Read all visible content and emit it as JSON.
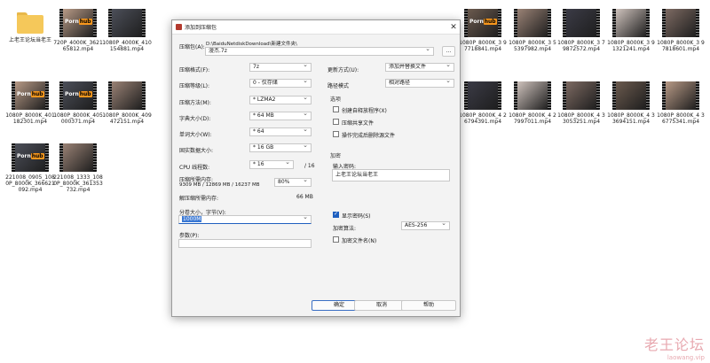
{
  "desktop": {
    "files": [
      {
        "name": "上老王论坛当老王",
        "kind": "folder"
      },
      {
        "name": "720P_4000K_362165812.mp4",
        "kind": "ph"
      },
      {
        "name": "1080P_4000K_410154881.mp4",
        "kind": "video"
      },
      {
        "name": "1080P_8000K_3 55397982.mp4",
        "kind": "video"
      },
      {
        "name": "1080P_8000K_3 79872572.mp4",
        "kind": "video"
      },
      {
        "name": "1080P_8000K_3 91321241.mp4",
        "kind": "video"
      },
      {
        "name": "1080P_8000K_3 97818601.mp4",
        "kind": "video"
      },
      {
        "name": "1080P_8000K_3 97718841.mp4",
        "kind": "ph"
      },
      {
        "name": "1080P_8000K_401182301.mp4",
        "kind": "ph"
      },
      {
        "name": "1080P_8000K_405000371.mp4",
        "kind": "ph"
      },
      {
        "name": "1080P_8000K_409472151.mp4",
        "kind": "video"
      },
      {
        "name": "1080P_8000K_4 26794391.mp4",
        "kind": "video"
      },
      {
        "name": "1080P_8000K_4 27997011.mp4",
        "kind": "video"
      },
      {
        "name": "1080P_8000K_4 33053251.mp4",
        "kind": "video"
      },
      {
        "name": "1080P_8000K_4 33694151.mp4",
        "kind": "video"
      },
      {
        "name": "1080P_8000K_4 36775341.mp4",
        "kind": "video"
      },
      {
        "name": "221008_0905_1080P_8000K_366621092.mp4",
        "kind": "ph"
      },
      {
        "name": "221008_1333_1080P_8000K_361353732.mp4",
        "kind": "video"
      }
    ],
    "ph_logo_text": "Porn",
    "ph_logo_badge": "hub"
  },
  "dialog": {
    "title": "添加到压缩包",
    "archive_label": "压缩包(A):",
    "archive_path": "D:\\BaiduNetdiskDownload\\新建文件夹\\",
    "archive_name": "漫杰.7z",
    "browse_label": "...",
    "format_label": "压缩格式(F):",
    "format_value": "7z",
    "level_label": "压缩等级(L):",
    "level_value": "0 - 仅存储",
    "method_label": "压缩方法(M):",
    "method_value": "* LZMA2",
    "dict_label": "字典大小(D):",
    "dict_value": "* 64 MB",
    "word_label": "单词大小(W):",
    "word_value": "* 64",
    "solid_label": "固实数据大小:",
    "solid_value": "* 16 GB",
    "cpu_label": "CPU 线程数:",
    "cpu_value": "* 16",
    "cpu_max": "/ 16",
    "mem_label": "压缩所需内存:",
    "mem_detail": "9309 MB / 12869 MB / 16237 MB",
    "mem_percent": "80%",
    "decomp_label": "解压缩所需内存:",
    "decomp_value": "66 MB",
    "split_label": "分卷大小，字节(V):",
    "split_value": "1000M",
    "params_label": "参数(P):",
    "params_value": "",
    "update_label": "更新方式(U):",
    "update_value": "添加并替换文件",
    "pathmode_label": "路径模式",
    "pathmode_value": "相对路径",
    "options_title": "选项",
    "opt_sfx": "创建自释放程序(X)",
    "opt_shared": "压缩共享文件",
    "opt_delete": "操作完成后删除源文件",
    "enc_title": "加密",
    "enc_pw_label": "输入密码:",
    "enc_pw_value": "上老王论坛当老王",
    "enc_show": "显示密码(S)",
    "enc_method_label": "加密算法:",
    "enc_method_value": "AES-256",
    "enc_names": "加密文件名(N)",
    "ok": "确定",
    "cancel": "取消",
    "help": "帮助"
  },
  "watermark": {
    "main": "老王论坛",
    "sub": "laowang.vip"
  }
}
